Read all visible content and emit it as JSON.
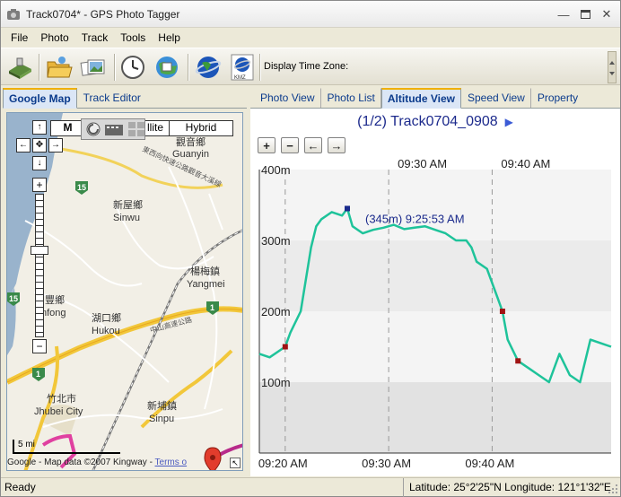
{
  "window": {
    "title": "Track0704* - GPS Photo Tagger"
  },
  "menu": {
    "items": [
      "File",
      "Photo",
      "Track",
      "Tools",
      "Help"
    ]
  },
  "toolbar": {
    "timezone_label": "Display Time Zone:",
    "kmz_label": "KMZ"
  },
  "left_tabs": [
    "Google Map",
    "Track Editor"
  ],
  "map": {
    "type_buttons": [
      "Map",
      "Satellite",
      "Hybrid"
    ],
    "visible_type_labels": [
      "M",
      "llite",
      "Hybrid"
    ],
    "places": [
      {
        "cn": "觀音鄉",
        "en": "Guanyin"
      },
      {
        "cn": "新屋鄉",
        "en": "Sinwu"
      },
      {
        "cn": "楊梅鎮",
        "en": "Yangmei"
      },
      {
        "cn": "湖口鄉",
        "en": "Hukou"
      },
      {
        "cn": "豐鄉",
        "en": "nfong"
      },
      {
        "cn": "竹北市",
        "en": "Jhubei City"
      },
      {
        "cn": "新埔鎮",
        "en": "Sinpu"
      }
    ],
    "road_labels": [
      "東西向快速公路觀音大溪線",
      "中山高速公路"
    ],
    "route_shields": [
      "15",
      "15",
      "1",
      "1"
    ],
    "scale": "5 mi",
    "attribution": "Google - Map data ©2007 Kingway -",
    "terms": "Terms o"
  },
  "right_tabs": [
    "Photo View",
    "Photo List",
    "Altitude View",
    "Speed View",
    "Property"
  ],
  "chart_header": {
    "title": "(1/2) Track0704_0908",
    "play_icon": "play-icon"
  },
  "zoom_buttons": [
    "+",
    "−",
    "←",
    "→"
  ],
  "chart_data": {
    "type": "line",
    "title": "",
    "xlabel": "",
    "ylabel": "",
    "x_ticks_top": [
      "09:30 AM",
      "09:40 AM"
    ],
    "x_ticks_bottom": [
      "09:20 AM",
      "09:30 AM",
      "09:40 AM"
    ],
    "y_ticks": [
      "400m",
      "300m",
      "200m",
      "100m"
    ],
    "ylim": [
      0,
      400
    ],
    "xlim_minutes": [
      0,
      30
    ],
    "series": [
      {
        "color": "#1ec39a",
        "x": [
          0,
          1,
          2.5,
          3,
          4,
          5,
          5.5,
          6,
          7,
          8,
          8.5,
          9,
          10,
          11,
          12,
          13,
          14,
          15,
          16,
          17,
          18,
          19,
          20,
          20.5,
          21,
          22,
          23,
          23.5,
          24,
          25,
          26,
          27,
          28,
          29,
          30,
          31,
          32,
          33,
          34
        ],
        "y": [
          140,
          135,
          150,
          170,
          200,
          290,
          320,
          330,
          340,
          335,
          345,
          320,
          310,
          315,
          318,
          322,
          316,
          318,
          320,
          315,
          310,
          300,
          300,
          290,
          270,
          260,
          220,
          200,
          160,
          130,
          120,
          110,
          100,
          140,
          110,
          100,
          160,
          155,
          150
        ]
      }
    ],
    "annotation": {
      "text": "(345m) 9:25:53 AM",
      "x": 8.5,
      "y": 345
    },
    "markers": [
      {
        "x": 2.5,
        "y": 150,
        "color": "#a01414"
      },
      {
        "x": 8.5,
        "y": 345,
        "color": "#1a2a8c"
      },
      {
        "x": 23.5,
        "y": 200,
        "color": "#a01414"
      },
      {
        "x": 25,
        "y": 130,
        "color": "#a01414"
      }
    ],
    "grid": true
  },
  "statusbar": {
    "status": "Ready",
    "coords": "Latitude: 25°2'25\"N  Longitude: 121°1'32\"E"
  }
}
